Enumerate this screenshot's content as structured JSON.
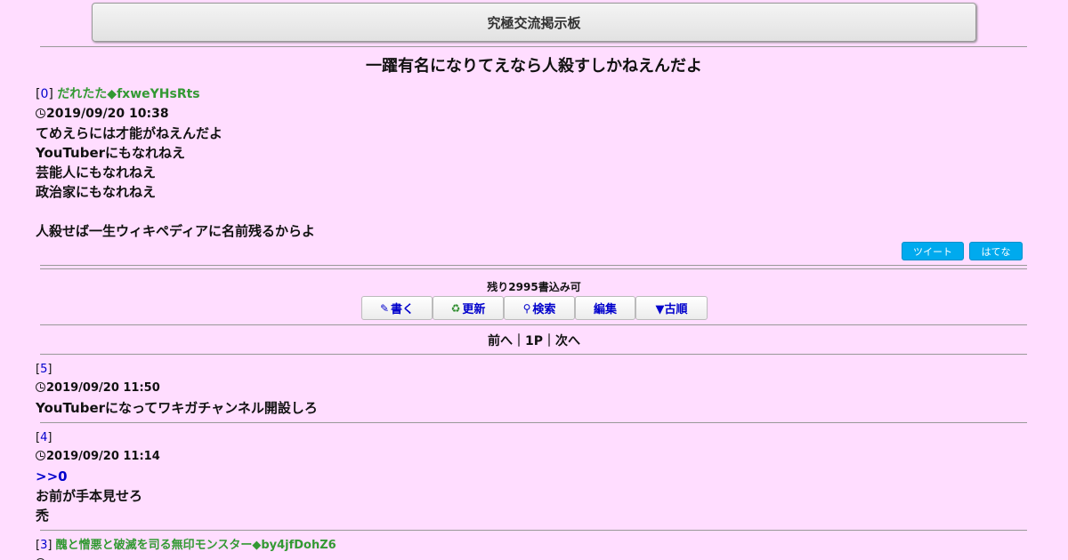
{
  "board": {
    "title": "究極交流掲示板"
  },
  "thread": {
    "title": "一躍有名になりてえなら人殺すしかねえんだよ"
  },
  "op": {
    "num": "0",
    "name": "だれたた◆fxweYHsRts",
    "date": "2019/09/20 10:38",
    "lines": [
      "てめえらには才能がねえんだよ",
      "YouTuberにもなれねえ",
      "芸能人にもなれねえ",
      "政治家にもなれねえ",
      "",
      "人殺せば一生ウィキペディアに名前残るからよ"
    ]
  },
  "share": {
    "tweet": "ツイート",
    "hatena": "はてな"
  },
  "controls": {
    "remaining": "残り2995書込み可",
    "write": "書く",
    "refresh": "更新",
    "search": "検索",
    "edit": "編集",
    "order": "▼古順"
  },
  "pager": {
    "prev": "前へ",
    "sep": "｜",
    "page": "1P",
    "next": "次へ"
  },
  "replies": [
    {
      "num": "5",
      "name": "",
      "date": "2019/09/20 11:50",
      "lines": [
        "YouTuberになってワキガチャンネル開設しろ"
      ]
    },
    {
      "num": "4",
      "name": "",
      "date": "2019/09/20 11:14",
      "anchor": ">>0",
      "lines": [
        "お前が手本見せろ",
        "禿"
      ]
    },
    {
      "num": "3",
      "name": "醜と憎悪と破滅を司る無印モンスター◆by4jfDohZ6"
    }
  ],
  "icons": {
    "clock": "clock-icon",
    "pencil": "pencil-icon",
    "refresh": "refresh-icon",
    "search": "search-icon"
  }
}
